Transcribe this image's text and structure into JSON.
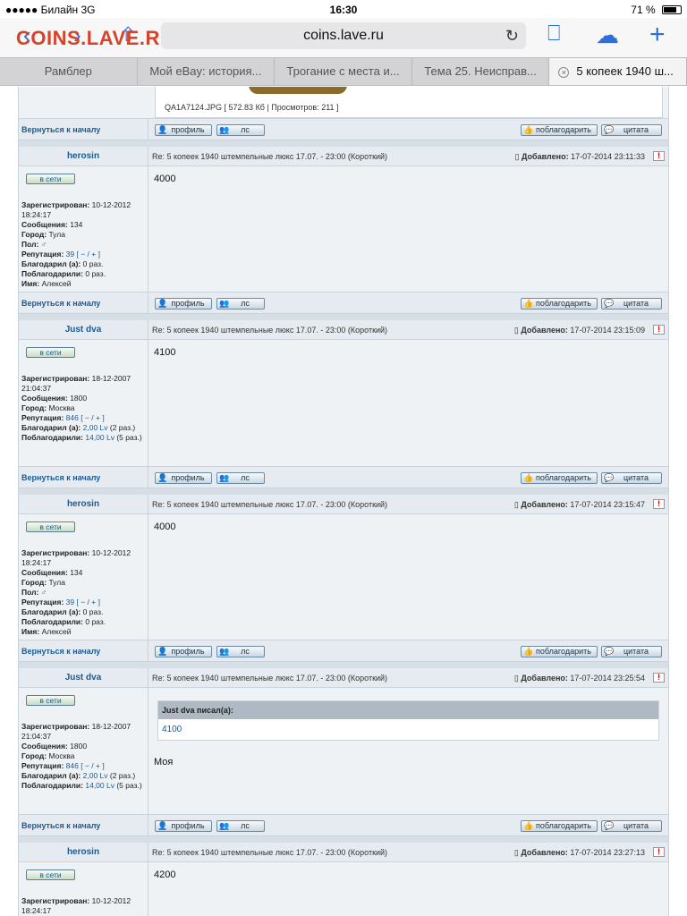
{
  "status": {
    "carrier": "●●●●● Билайн  3G",
    "time": "16:30",
    "battery": "71 %"
  },
  "browser": {
    "logo": "COINS.LAVE.RU",
    "url": "coins.lave.ru",
    "tabs": [
      {
        "label": "Рамблер"
      },
      {
        "label": "Мой eBay: история..."
      },
      {
        "label": "Трогание с места и..."
      },
      {
        "label": "Тема 25. Неисправ..."
      },
      {
        "label": "5 копеек 1940 ш..."
      }
    ]
  },
  "forum": {
    "image_caption": "QA1A7124.JPG [ 572.83 Кб | Просмотров: 211 ]",
    "back_to_top": "Вернуться к началу",
    "btn_profile": "профиль",
    "btn_pm": "лс",
    "btn_thank": "поблагодарить",
    "btn_quote": "цитата",
    "online": "в сети",
    "subject": "Re: 5 копеек 1940 штемпельные люкс 17.07. - 23:00 (Короткий)",
    "added_label": "Добавлено:",
    "labels": {
      "registered": "Зарегистрирован:",
      "messages": "Сообщения:",
      "city": "Город:",
      "gender": "Пол:",
      "reputation": "Репутация:",
      "thanked": "Благодарил (а):",
      "got_thanks": "Поблагодарили:",
      "name": "Имя:"
    },
    "rep_controls": "[ − / + ]",
    "posts": [
      {
        "author": "herosin",
        "date": "17-07-2014 23:11:33",
        "registered": "10-12-2012 18:24:17",
        "messages": "134",
        "city": "Тула",
        "gender": "♂",
        "reputation": "39",
        "thanked": "0 раз.",
        "got_thanks": "0 раз.",
        "name": "Алексей",
        "text": "4000"
      },
      {
        "author": "Just dva",
        "date": "17-07-2014 23:15:09",
        "registered": "18-12-2007 21:04:37",
        "messages": "1800",
        "city": "Москва",
        "reputation": "846",
        "thanked": "2,00 Lv",
        "thanked_suffix": " (2 раз.)",
        "got_thanks": "14,00 Lv",
        "got_thanks_suffix": " (5 раз.)",
        "text": "4100"
      },
      {
        "author": "herosin",
        "date": "17-07-2014 23:15:47",
        "registered": "10-12-2012 18:24:17",
        "messages": "134",
        "city": "Тула",
        "gender": "♂",
        "reputation": "39",
        "thanked": "0 раз.",
        "got_thanks": "0 раз.",
        "name": "Алексей",
        "text": "4000"
      },
      {
        "author": "Just dva",
        "date": "17-07-2014 23:25:54",
        "registered": "18-12-2007 21:04:37",
        "messages": "1800",
        "city": "Москва",
        "reputation": "846",
        "thanked": "2,00 Lv",
        "thanked_suffix": " (2 раз.)",
        "got_thanks": "14,00 Lv",
        "got_thanks_suffix": " (5 раз.)",
        "quote_header": "Just dva писал(а):",
        "quote_text": "4100",
        "text": "Моя"
      },
      {
        "author": "herosin",
        "date": "17-07-2014 23:27:13",
        "registered": "10-12-2012 18:24:17",
        "text": "4200"
      }
    ]
  },
  "colors": {
    "accent": "#2a6fdb",
    "logo": "#d6432a",
    "forum_link": "#1a5b93"
  }
}
